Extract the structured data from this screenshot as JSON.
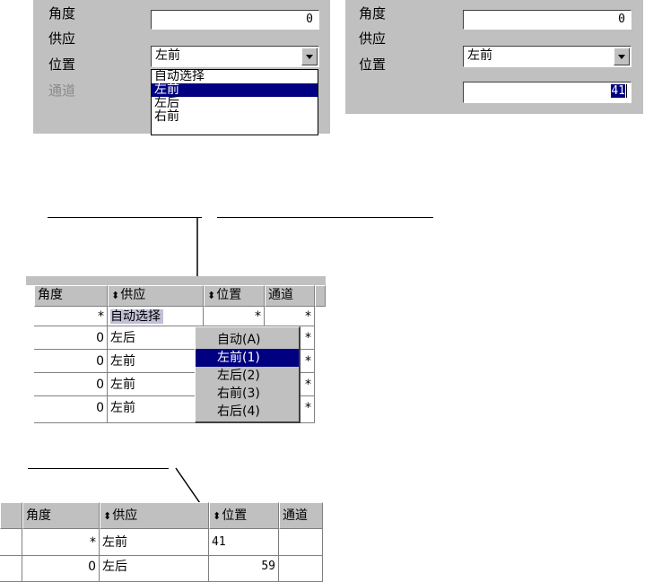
{
  "panel1": {
    "labels": [
      "角度",
      "供应",
      "位置",
      "通道"
    ],
    "angle_value": "0",
    "supply_value": "左前",
    "dropdown_options": [
      "自动选择",
      "左前",
      "左后",
      "右前"
    ],
    "selected_index": 1
  },
  "panel2": {
    "labels": [
      "角度",
      "供应",
      "位置"
    ],
    "angle_value": "0",
    "supply_value": "左前",
    "position_value": "41"
  },
  "grid1": {
    "headers": [
      "角度",
      "供应",
      "位置",
      "通道"
    ],
    "rows": [
      {
        "angle": "*",
        "supply": "自动选择",
        "pos": "*",
        "ch": "*"
      },
      {
        "angle": "0",
        "supply": "左后",
        "pos": "",
        "ch": "*"
      },
      {
        "angle": "0",
        "supply": "左前",
        "pos": "",
        "ch": "*"
      },
      {
        "angle": "0",
        "supply": "左前",
        "pos": "",
        "ch": "*"
      },
      {
        "angle": "0",
        "supply": "左前",
        "pos": "",
        "ch": "*"
      }
    ],
    "menu": [
      "自动(A)",
      "左前(1)",
      "左后(2)",
      "右前(3)",
      "右后(4)"
    ],
    "menu_selected_index": 1
  },
  "grid2": {
    "headers": [
      "角度",
      "供应",
      "位置",
      "通道"
    ],
    "rows": [
      {
        "angle": "*",
        "supply": "左前",
        "pos": "41"
      },
      {
        "angle": "0",
        "supply": "左后",
        "pos": "59"
      }
    ]
  },
  "icons": {
    "sort": "sort-updown-icon",
    "dropdown": "chevron-down-icon"
  }
}
